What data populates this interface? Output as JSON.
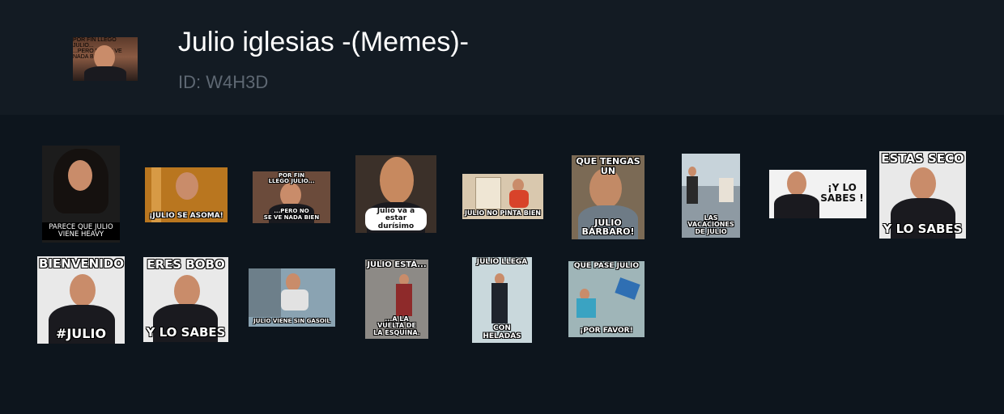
{
  "pack": {
    "title": "Julio iglesias -(Memes)-",
    "id_text": "ID: W4H3D",
    "thumbnail_caption_top": "POR FIN\nLLEGO JULIO...",
    "thumbnail_caption_bottom": "...PERO NO\nSE VE NADA BIEN"
  },
  "stickers": [
    {
      "top": "",
      "bottom": "PARECE QUE JULIO\nVIENE HEAVY",
      "bg": "#1c1c1c"
    },
    {
      "top": "",
      "bottom": "¡JULIO SE ASOMA!",
      "bg": "#b9761f"
    },
    {
      "top": "POR FIN\nLLEGO JULIO...",
      "bottom": "...PERO NO\nSE VE NADA BIEN",
      "bg": "#6b4b3b"
    },
    {
      "top": "",
      "bottom": "Julio va a estar\ndurísimo",
      "bg": "#3b3029"
    },
    {
      "top": "",
      "bottom": "JULIO NO PINTA BIEN",
      "bg": "#d9c8ae"
    },
    {
      "top": "QUE TENGAS UN",
      "bottom": "JULIO BÁRBARO!",
      "bg": "#7b6a55"
    },
    {
      "top": "",
      "bottom": "LAS VACACIONES\nDE JULIO",
      "bg": "#8e9aa3"
    },
    {
      "top": "",
      "bottom": "¡Y LO\nSABES !",
      "bg": "#f2f2f2"
    },
    {
      "top": "ESTAS SECO",
      "bottom": "Y LO SABES",
      "bg": "#e9e9e9"
    },
    {
      "top": "BIENVENIDO",
      "bottom": "#JULIO",
      "bg": "#e9e9e9"
    },
    {
      "top": "ERES BOBO",
      "bottom": "Y LO SABES",
      "bg": "#e9e9e9"
    },
    {
      "top": "",
      "bottom": "JULIO VIENE SIN GASOIL",
      "bg": "#8aa3b2"
    },
    {
      "top": "JULIO ESTÁ...",
      "bottom": "...A LA\nVUELTA DE\nLA ESQUINA.",
      "bg": "#8d8a86"
    },
    {
      "top": "JULIO LLEGA",
      "bottom": "CON HELADAS",
      "bg": "#c9d8dc"
    },
    {
      "top": "QUE PASE JULIO",
      "bottom": "¡POR FAVOR!",
      "bg": "#9fb5b8"
    }
  ]
}
